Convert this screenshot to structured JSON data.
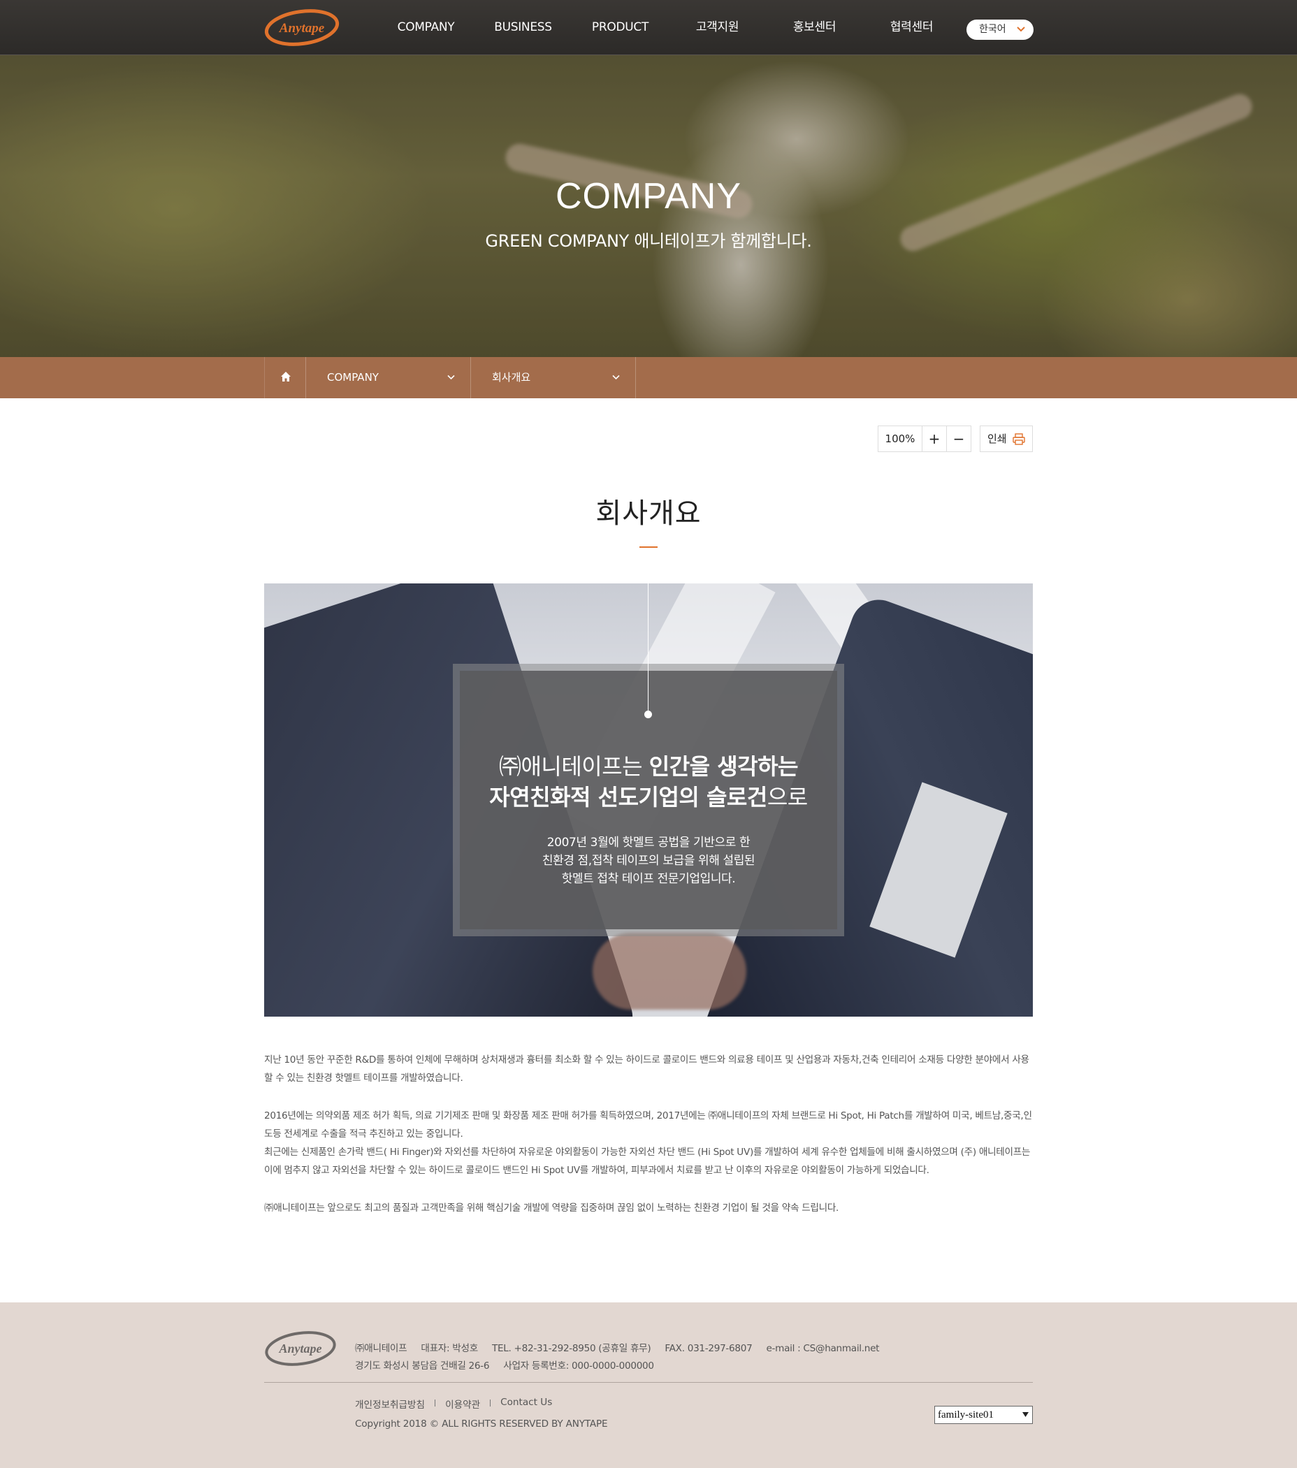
{
  "header": {
    "logo_text": "Anytape",
    "nav": [
      "COMPANY",
      "BUSINESS",
      "PRODUCT",
      "고객지원",
      "홍보센터",
      "협력센터"
    ],
    "language": "한국어"
  },
  "hero": {
    "title": "COMPANY",
    "subtitle": "GREEN COMPANY 애니테이프가 함께합니다."
  },
  "breadcrumb": {
    "level1": "COMPANY",
    "level2": "회사개요"
  },
  "tools": {
    "zoom": "100%",
    "zoom_in": "+",
    "zoom_out": "−",
    "print": "인쇄"
  },
  "page": {
    "title": "회사개요"
  },
  "feature": {
    "line1_light": "㈜애니테이프는 ",
    "line1_bold": "인간을 생각하는",
    "line2_bold": "자연친화적 선도기업의 슬로건",
    "line2_light": "으로",
    "desc1": "2007년 3월에 핫멜트 공법을 기반으로 한",
    "desc2": "친환경 점,접착 테이프의 보급을 위해 설립된",
    "desc3": "핫멜트 접착 테이프 전문기업입니다."
  },
  "body": {
    "p1": "지난 10년 동안 꾸준한 R&D를 통하여 인체에 무해하며 상처재생과 흉터를 최소화 할 수 있는 하이드로 콜로이드 밴드와 의료용 테이프 및 산업용과 자동차,건축 인테리어 소재등 다양한 분야에서 사용할 수 있는 친환경 핫멜트 테이프를 개발하였습니다.",
    "p2a": "2016년에는 의약외품 제조 허가 획득,  의료 기기제조 판매 및 화장품 제조 판매 허가를  획득하였으며, 2017년에는 ㈜애니테이프의 자체 브랜드로 Hi Spot, Hi Patch를 개발하여 미국, 베트남,중국,인도등 전세계로 수출을 적극 추진하고 있는 중입니다.",
    "p2b": "최근에는 신제품인  손가락 밴드( Hi Finger)와 자외선를 차단하여 자유로운 야외활동이 가능한 자외선 차단 밴드 (Hi Spot UV)를 개발하여 세계 유수한 업체들에 비해  출시하였으며 (주) 애니테이프는 이에 멈추지 않고 자외선을 차단할 수 있는 하이드로 콜로이드 밴드인 Hi Spot UV를 개발하여, 피부과에서 치료를 받고 난 이후의 자유로운 야외활동이 가능하게 되었습니다.",
    "p3": "㈜애니테이프는 앞으로도 최고의 품질과 고객만족을 위해 핵심기술 개발에 역량을 집중하며 끊임 없이 노력하는 친환경 기업이 될 것을 약속 드립니다."
  },
  "footer": {
    "logo_text": "Anytape",
    "company": "㈜애니테이프",
    "ceo": "대표자: 박성호",
    "tel": "TEL. +82-31-292-8950 (공휴일 휴무)",
    "fax": "FAX. 031-297-6807",
    "email": "e-mail : CS@hanmail.net",
    "address": "경기도 화성시 봉담읍 건배길 26-6",
    "biz_no": "사업자 등록번호: 000-0000-000000",
    "links": [
      "개인정보취급방침",
      "이용약관",
      "Contact Us"
    ],
    "copyright": "Copyright 2018 © ALL RIGHTS RESERVED BY ANYTAPE",
    "family_site": "family-site01"
  },
  "colors": {
    "accent": "#e0722c",
    "header_bg": "#2f2d2b",
    "crumb_bg": "#9b5f3c",
    "footer_bg": "#e2d7d1"
  }
}
